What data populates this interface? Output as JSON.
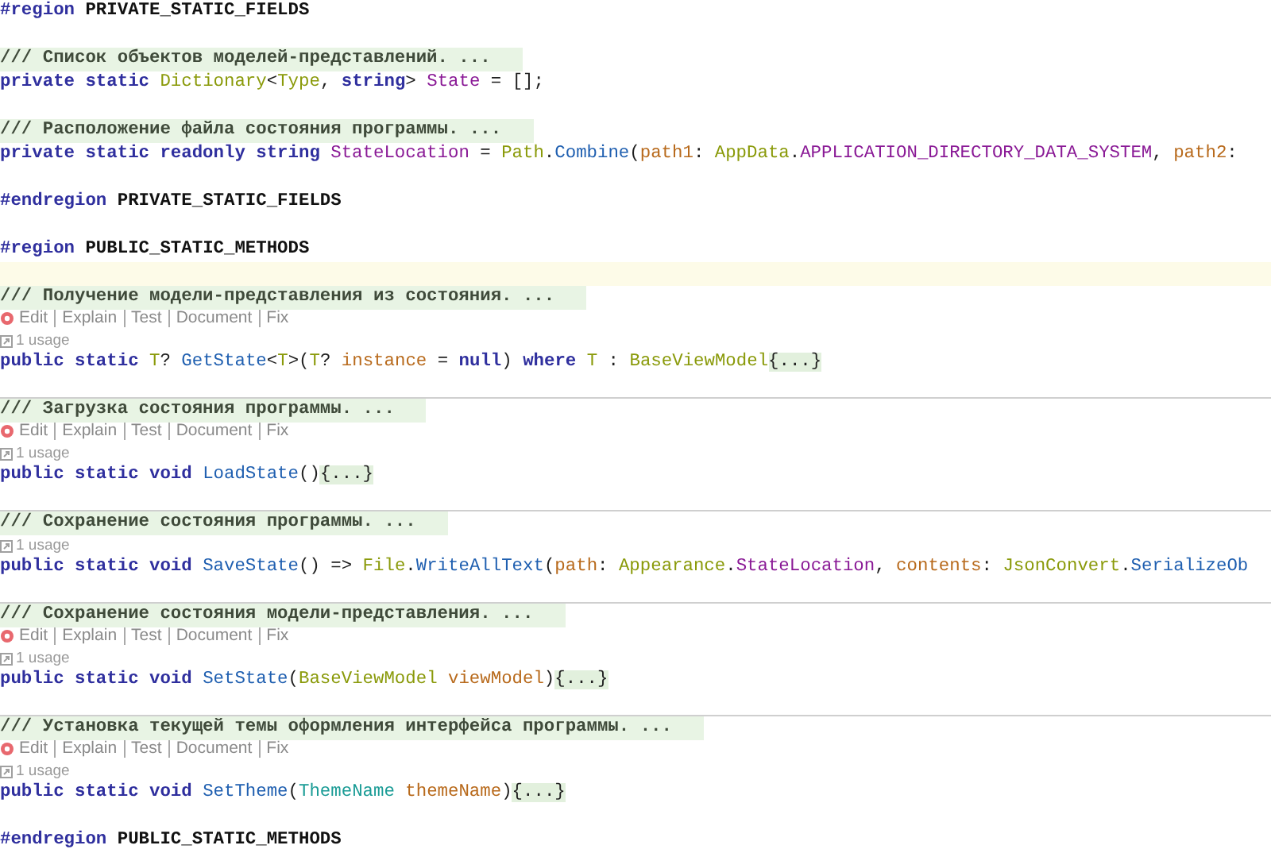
{
  "lines": [
    {
      "kind": "code",
      "tokens": [
        {
          "kind": "directive",
          "text": "#region"
        },
        {
          "kind": "region_name",
          "text": " PRIVATE_STATIC_FIELDS"
        }
      ]
    },
    {
      "kind": "blank"
    },
    {
      "kind": "comment",
      "text": "/// Список объектов моделей-представлений. ..."
    },
    {
      "kind": "code",
      "tokens": [
        {
          "kind": "keyword",
          "text": "private static "
        },
        {
          "kind": "type",
          "text": "Dictionary"
        },
        {
          "kind": "plain",
          "text": "<"
        },
        {
          "kind": "type",
          "text": "Type"
        },
        {
          "kind": "plain",
          "text": ", "
        },
        {
          "kind": "keyword",
          "text": "string"
        },
        {
          "kind": "plain",
          "text": "> "
        },
        {
          "kind": "field",
          "text": "State"
        },
        {
          "kind": "plain",
          "text": " = [];"
        }
      ]
    },
    {
      "kind": "blank"
    },
    {
      "kind": "comment",
      "text": "/// Расположение файла состояния программы. ..."
    },
    {
      "kind": "code",
      "tokens": [
        {
          "kind": "keyword",
          "text": "private static readonly string "
        },
        {
          "kind": "field",
          "text": "StateLocation"
        },
        {
          "kind": "plain",
          "text": " = "
        },
        {
          "kind": "type",
          "text": "Path"
        },
        {
          "kind": "plain",
          "text": "."
        },
        {
          "kind": "method",
          "text": "Combine"
        },
        {
          "kind": "plain",
          "text": "("
        },
        {
          "kind": "param",
          "text": "path1"
        },
        {
          "kind": "plain",
          "text": ": "
        },
        {
          "kind": "type",
          "text": "AppData"
        },
        {
          "kind": "plain",
          "text": "."
        },
        {
          "kind": "field",
          "text": "APPLICATION_DIRECTORY_DATA_SYSTEM"
        },
        {
          "kind": "plain",
          "text": ", "
        },
        {
          "kind": "param",
          "text": "path2"
        },
        {
          "kind": "plain",
          "text": ":"
        }
      ]
    },
    {
      "kind": "blank"
    },
    {
      "kind": "code",
      "tokens": [
        {
          "kind": "directive",
          "text": "#endregion"
        },
        {
          "kind": "region_name",
          "text": " PRIVATE_STATIC_FIELDS"
        }
      ]
    },
    {
      "kind": "blank"
    },
    {
      "kind": "code",
      "tokens": [
        {
          "kind": "directive",
          "text": "#region"
        },
        {
          "kind": "region_name",
          "text": " PUBLIC_STATIC_METHODS"
        }
      ]
    },
    {
      "kind": "current_line"
    },
    {
      "kind": "comment",
      "text": "/// Получение модели-представления из состояния. ..."
    },
    {
      "kind": "actions",
      "items": [
        "Edit",
        "Explain",
        "Test",
        "Document",
        "Fix"
      ]
    },
    {
      "kind": "usages",
      "text": "1 usage"
    },
    {
      "kind": "code",
      "tokens": [
        {
          "kind": "keyword",
          "text": "public static "
        },
        {
          "kind": "type",
          "text": "T"
        },
        {
          "kind": "plain",
          "text": "? "
        },
        {
          "kind": "method",
          "text": "GetState"
        },
        {
          "kind": "plain",
          "text": "<"
        },
        {
          "kind": "type",
          "text": "T"
        },
        {
          "kind": "plain",
          "text": ">("
        },
        {
          "kind": "type",
          "text": "T"
        },
        {
          "kind": "plain",
          "text": "? "
        },
        {
          "kind": "param",
          "text": "instance"
        },
        {
          "kind": "plain",
          "text": " = "
        },
        {
          "kind": "keyword",
          "text": "null"
        },
        {
          "kind": "plain",
          "text": ") "
        },
        {
          "kind": "keyword",
          "text": "where "
        },
        {
          "kind": "type",
          "text": "T"
        },
        {
          "kind": "plain",
          "text": " : "
        },
        {
          "kind": "type",
          "text": "BaseViewModel"
        },
        {
          "kind": "folded",
          "text": "{...}"
        }
      ]
    },
    {
      "kind": "separator"
    },
    {
      "kind": "comment",
      "text": "/// Загрузка состояния программы. ..."
    },
    {
      "kind": "actions",
      "items": [
        "Edit",
        "Explain",
        "Test",
        "Document",
        "Fix"
      ]
    },
    {
      "kind": "usages",
      "text": "1 usage"
    },
    {
      "kind": "code",
      "tokens": [
        {
          "kind": "keyword",
          "text": "public static void "
        },
        {
          "kind": "method",
          "text": "LoadState"
        },
        {
          "kind": "plain",
          "text": "()"
        },
        {
          "kind": "folded",
          "text": "{...}"
        }
      ]
    },
    {
      "kind": "separator"
    },
    {
      "kind": "comment",
      "text": "/// Сохранение состояния программы. ..."
    },
    {
      "kind": "usages",
      "text": "1 usage"
    },
    {
      "kind": "code",
      "tokens": [
        {
          "kind": "keyword",
          "text": "public static void "
        },
        {
          "kind": "method",
          "text": "SaveState"
        },
        {
          "kind": "plain",
          "text": "() => "
        },
        {
          "kind": "type",
          "text": "File"
        },
        {
          "kind": "plain",
          "text": "."
        },
        {
          "kind": "method",
          "text": "WriteAllText"
        },
        {
          "kind": "plain",
          "text": "("
        },
        {
          "kind": "param",
          "text": "path"
        },
        {
          "kind": "plain",
          "text": ": "
        },
        {
          "kind": "type",
          "text": "Appearance"
        },
        {
          "kind": "plain",
          "text": "."
        },
        {
          "kind": "field",
          "text": "StateLocation"
        },
        {
          "kind": "plain",
          "text": ", "
        },
        {
          "kind": "param",
          "text": "contents"
        },
        {
          "kind": "plain",
          "text": ": "
        },
        {
          "kind": "type",
          "text": "JsonConvert"
        },
        {
          "kind": "plain",
          "text": "."
        },
        {
          "kind": "method",
          "text": "SerializeOb"
        }
      ]
    },
    {
      "kind": "separator"
    },
    {
      "kind": "comment",
      "text": "/// Сохранение состояния модели-представления. ..."
    },
    {
      "kind": "actions",
      "items": [
        "Edit",
        "Explain",
        "Test",
        "Document",
        "Fix"
      ]
    },
    {
      "kind": "usages",
      "text": "1 usage"
    },
    {
      "kind": "code",
      "tokens": [
        {
          "kind": "keyword",
          "text": "public static void "
        },
        {
          "kind": "method",
          "text": "SetState"
        },
        {
          "kind": "plain",
          "text": "("
        },
        {
          "kind": "type",
          "text": "BaseViewModel"
        },
        {
          "kind": "param",
          "text": " viewModel"
        },
        {
          "kind": "plain",
          "text": ")"
        },
        {
          "kind": "folded",
          "text": "{...}"
        }
      ]
    },
    {
      "kind": "separator"
    },
    {
      "kind": "comment",
      "text": "/// Установка текущей темы оформления интерфейса программы. ..."
    },
    {
      "kind": "actions",
      "items": [
        "Edit",
        "Explain",
        "Test",
        "Document",
        "Fix"
      ]
    },
    {
      "kind": "usages",
      "text": "1 usage"
    },
    {
      "kind": "code",
      "tokens": [
        {
          "kind": "keyword",
          "text": "public static void "
        },
        {
          "kind": "method",
          "text": "SetTheme"
        },
        {
          "kind": "plain",
          "text": "("
        },
        {
          "kind": "enum",
          "text": "ThemeName"
        },
        {
          "kind": "param",
          "text": " themeName"
        },
        {
          "kind": "plain",
          "text": ")"
        },
        {
          "kind": "folded",
          "text": "{...}"
        }
      ]
    },
    {
      "kind": "blank"
    },
    {
      "kind": "code",
      "tokens": [
        {
          "kind": "directive",
          "text": "#endregion"
        },
        {
          "kind": "region_name",
          "text": " PUBLIC_STATIC_METHODS"
        }
      ]
    }
  ]
}
